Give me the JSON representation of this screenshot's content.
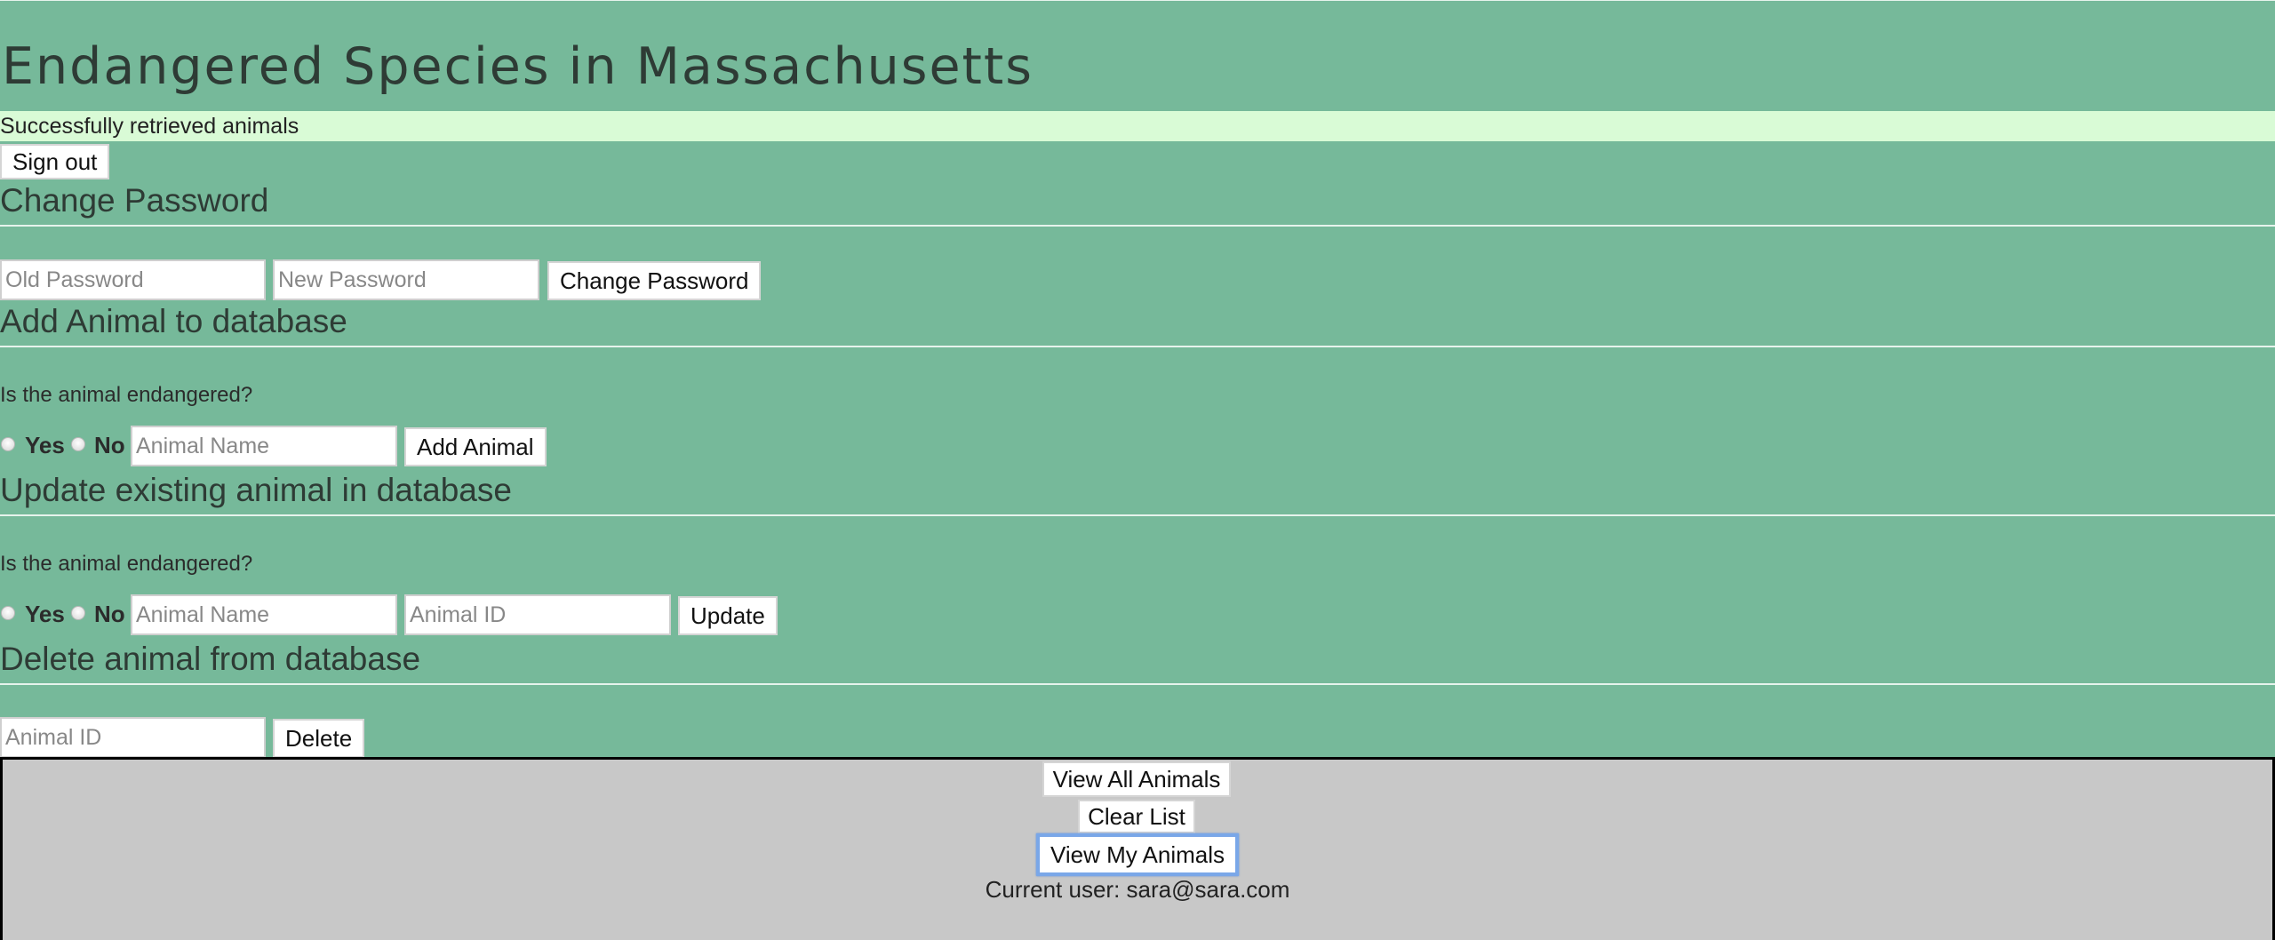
{
  "header": {
    "title": "Endangered Species in Massachusetts"
  },
  "status": {
    "message": "Successfully retrieved animals"
  },
  "auth": {
    "sign_out_label": "Sign out"
  },
  "change_password": {
    "title": "Change Password",
    "old_placeholder": "Old Password",
    "new_placeholder": "New Password",
    "button_label": "Change Password"
  },
  "add_animal": {
    "title": "Add Animal to database",
    "question": "Is the animal endangered?",
    "yes_label": "Yes",
    "no_label": "No",
    "name_placeholder": "Animal Name",
    "button_label": "Add Animal"
  },
  "update_animal": {
    "title": "Update existing animal in database",
    "question": "Is the animal endangered?",
    "yes_label": "Yes",
    "no_label": "No",
    "name_placeholder": "Animal Name",
    "id_placeholder": "Animal ID",
    "button_label": "Update"
  },
  "delete_animal": {
    "title": "Delete animal from database",
    "id_placeholder": "Animal ID",
    "button_label": "Delete"
  },
  "list_panel": {
    "view_all_label": "View All Animals",
    "clear_label": "Clear List",
    "view_mine_label": "View My Animals",
    "current_user_text": "Current user: sara@sara.com"
  }
}
